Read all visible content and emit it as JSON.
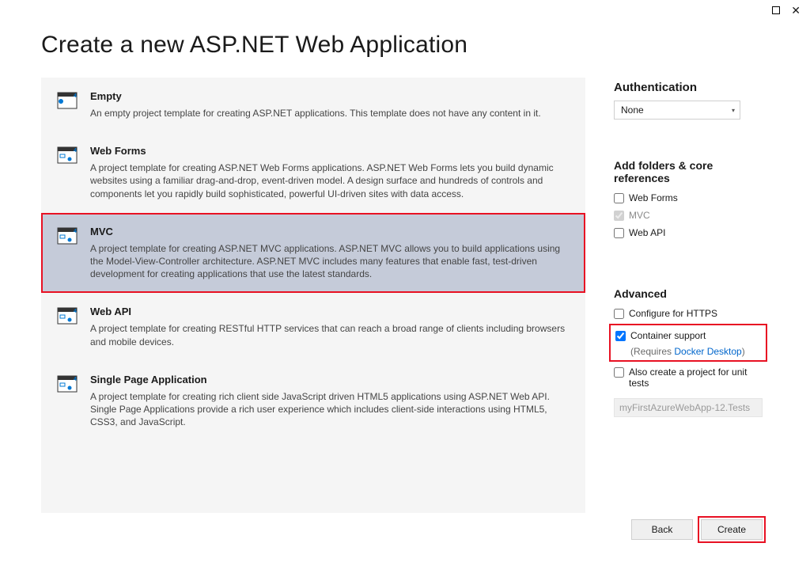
{
  "title": "Create a new ASP.NET Web Application",
  "templates": [
    {
      "name": "Empty",
      "desc": "An empty project template for creating ASP.NET applications. This template does not have any content in it."
    },
    {
      "name": "Web Forms",
      "desc": "A project template for creating ASP.NET Web Forms applications. ASP.NET Web Forms lets you build dynamic websites using a familiar drag-and-drop, event-driven model. A design surface and hundreds of controls and components let you rapidly build sophisticated, powerful UI-driven sites with data access."
    },
    {
      "name": "MVC",
      "desc": "A project template for creating ASP.NET MVC applications. ASP.NET MVC allows you to build applications using the Model-View-Controller architecture. ASP.NET MVC includes many features that enable fast, test-driven development for creating applications that use the latest standards."
    },
    {
      "name": "Web API",
      "desc": "A project template for creating RESTful HTTP services that can reach a broad range of clients including browsers and mobile devices."
    },
    {
      "name": "Single Page Application",
      "desc": "A project template for creating rich client side JavaScript driven HTML5 applications using ASP.NET Web API. Single Page Applications provide a rich user experience which includes client-side interactions using HTML5, CSS3, and JavaScript."
    }
  ],
  "auth": {
    "heading": "Authentication",
    "selected": "None"
  },
  "core": {
    "heading": "Add folders & core references",
    "webforms": "Web Forms",
    "mvc": "MVC",
    "webapi": "Web API"
  },
  "advanced": {
    "heading": "Advanced",
    "https": "Configure for HTTPS",
    "container": "Container support",
    "requires_prefix": "(Requires ",
    "requires_link": "Docker Desktop",
    "requires_suffix": ")",
    "unit_tests": "Also create a project for unit tests",
    "test_project": "myFirstAzureWebApp-12.Tests"
  },
  "buttons": {
    "back": "Back",
    "create": "Create"
  }
}
